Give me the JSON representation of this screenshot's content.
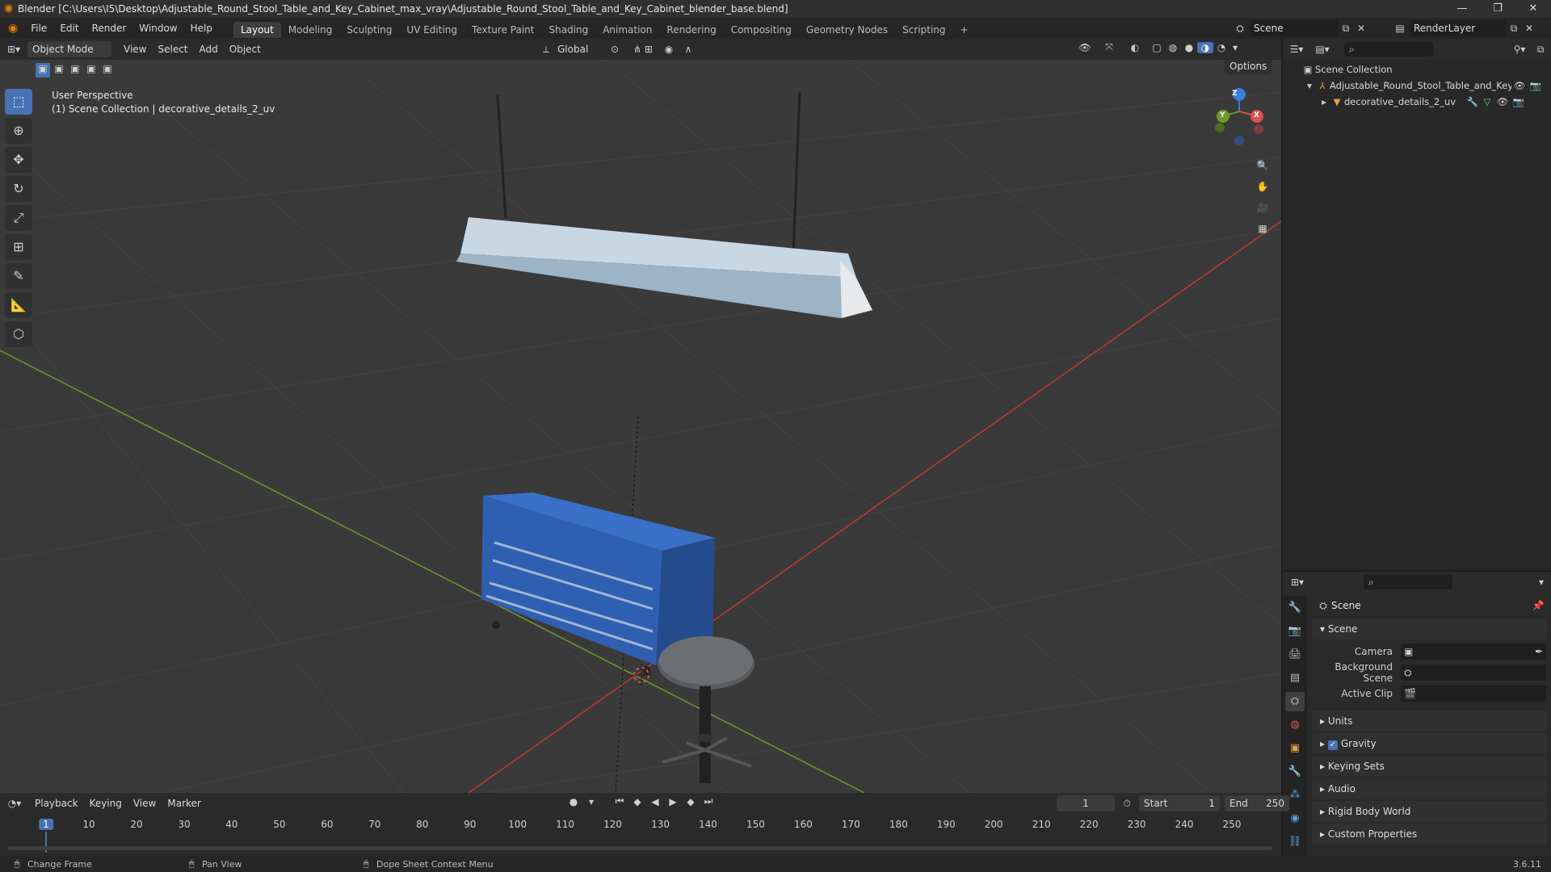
{
  "window": {
    "title": "Blender [C:\\Users\\I5\\Desktop\\Adjustable_Round_Stool_Table_and_Key_Cabinet_max_vray\\Adjustable_Round_Stool_Table_and_Key_Cabinet_blender_base.blend]",
    "minimize": "—",
    "maximize": "❐",
    "close": "✕"
  },
  "menu": {
    "items": [
      "File",
      "Edit",
      "Render",
      "Window",
      "Help"
    ],
    "workspaces": [
      "Layout",
      "Modeling",
      "Sculpting",
      "UV Editing",
      "Texture Paint",
      "Shading",
      "Animation",
      "Rendering",
      "Compositing",
      "Geometry Nodes",
      "Scripting"
    ],
    "add_tab": "+",
    "scene_label": "Scene",
    "render_layer_label": "RenderLayer"
  },
  "viewport_header": {
    "mode": "Object Mode",
    "menus": [
      "View",
      "Select",
      "Add",
      "Object"
    ],
    "transform_orientation": "Global",
    "options": "Options"
  },
  "viewport": {
    "perspective": "User Perspective",
    "collection_info": "(1) Scene Collection | decorative_details_2_uv",
    "gizmo": {
      "x": "X",
      "y": "Y",
      "z": "Z"
    }
  },
  "outliner": {
    "root": "Scene Collection",
    "items": [
      {
        "name": "Adjustable_Round_Stool_Table_and_Key"
      },
      {
        "name": "decorative_details_2_uv"
      }
    ]
  },
  "properties": {
    "context": "Scene",
    "panel_scene": "Scene",
    "fields": [
      {
        "label": "Camera",
        "value": ""
      },
      {
        "label": "Background Scene",
        "value": ""
      },
      {
        "label": "Active Clip",
        "value": ""
      }
    ],
    "subpanels": [
      "Units",
      "Gravity",
      "Keying Sets",
      "Audio",
      "Rigid Body World",
      "Custom Properties"
    ],
    "gravity_checked": true
  },
  "timeline": {
    "menus": [
      "Playback",
      "Keying",
      "View",
      "Marker"
    ],
    "current_frame": "1",
    "start_label": "Start",
    "start_value": "1",
    "end_label": "End",
    "end_value": "250",
    "ticks": [
      "1",
      "10",
      "20",
      "30",
      "40",
      "50",
      "60",
      "70",
      "80",
      "90",
      "100",
      "110",
      "120",
      "130",
      "140",
      "150",
      "160",
      "170",
      "180",
      "190",
      "200",
      "210",
      "220",
      "230",
      "240",
      "250"
    ]
  },
  "statusbar": {
    "hint1": "Change Frame",
    "hint2": "Pan View",
    "hint3": "Dope Sheet Context Menu",
    "version": "3.6.11"
  },
  "colors": {
    "accent": "#4772b3",
    "cabinet": "#2f5fb0",
    "lamp": "#a9c2d9",
    "x_axis": "#c0392b",
    "y_axis": "#6a9a2a"
  }
}
